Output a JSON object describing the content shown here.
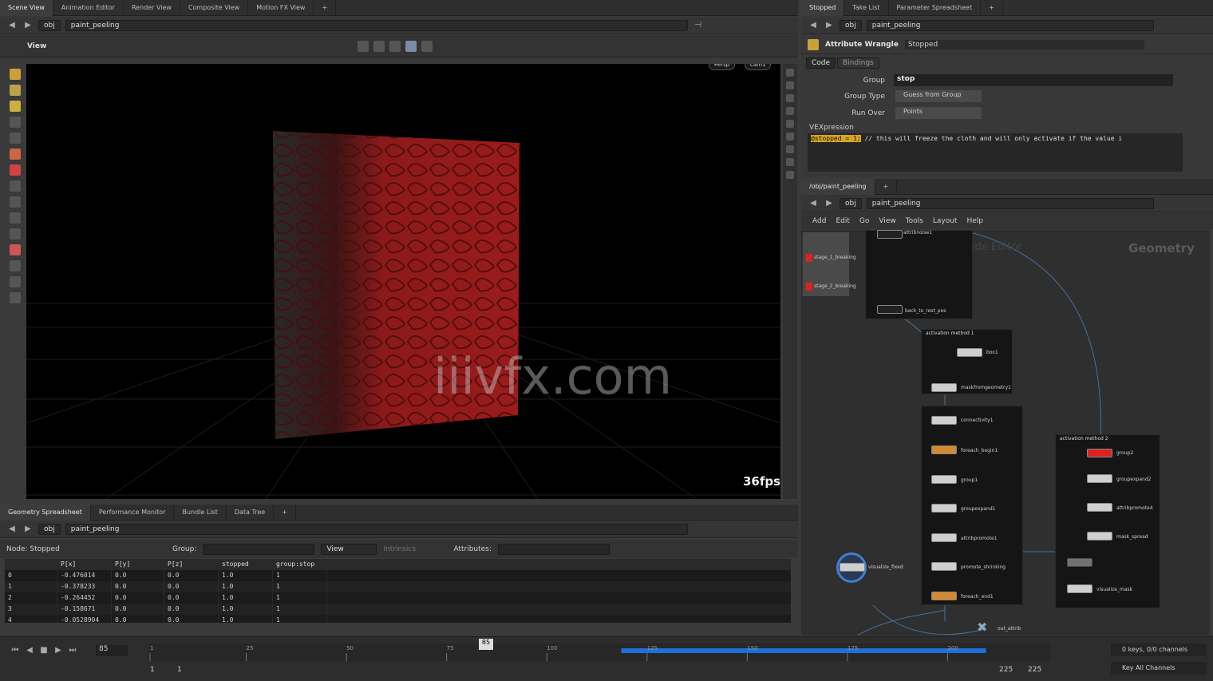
{
  "left_tabs": [
    "Scene View",
    "Animation Editor",
    "Render View",
    "Composite View",
    "Motion FX View"
  ],
  "right_tabs": [
    "Stopped",
    "Take List",
    "Parameter Spreadsheet"
  ],
  "path": {
    "obj": "obj",
    "node": "paint_peeling"
  },
  "viewer": {
    "title": "View",
    "persp": "Persp",
    "cam": "cam1",
    "fps": "36fps",
    "watermark": "iiivfx.com"
  },
  "wrangle": {
    "type": "Attribute Wrangle",
    "name": "Stopped",
    "tabs": [
      "Code",
      "Bindings"
    ],
    "group_label": "Group",
    "group_value": "stop",
    "group_type_label": "Group Type",
    "group_type_value": "Guess from Group",
    "run_over_label": "Run Over",
    "run_over_value": "Points",
    "vex_label": "VEXpression",
    "vex_highlight": "@stopped = 1;",
    "vex_comment": " // this will freeze the cloth and will only activate if the value i"
  },
  "network": {
    "path_tab": "/obj/paint_peeling",
    "menu": [
      "Add",
      "Edit",
      "Go",
      "View",
      "Tools",
      "Layout",
      "Help"
    ],
    "geo_label": "Geometry",
    "box1_title": "activation method 1",
    "box2_title": "activation method 2",
    "nodes": {
      "attribnoise1": "attribnoise1",
      "back": "back_to_rest_pos",
      "stage1": "stage_1_breaking",
      "stage2": "stage_2_breaking",
      "box1": "box1",
      "maskfrom": "maskfromgeometry1",
      "connectivity": "connectivity1",
      "foreach_begin": "foreach_begin1",
      "group1": "group1",
      "groupexpand": "groupexpand1",
      "attribpromote1": "attribpromote1",
      "promote_shrinking": "promote_shrinking",
      "foreach_end": "foreach_end1",
      "visualize_fixed": "visualize_fixed",
      "out_attrib": "out_attrib",
      "group2": "group2",
      "groupexpand2": "groupexpand2",
      "attribpromote4": "attribpromote4",
      "mask_spread": "mask_spread",
      "visualize_mask": "visualize_mask"
    }
  },
  "spreadsheet": {
    "tabs": [
      "Geometry Spreadsheet",
      "Performance Monitor",
      "Bundle List",
      "Data Tree"
    ],
    "node_label": "Node: Stopped",
    "group_label": "Group:",
    "view_label": "View",
    "intrinsics_label": "Intrinsics",
    "attributes_label": "Attributes:",
    "columns": [
      "",
      "P[x]",
      "P[y]",
      "P[z]",
      "stopped",
      "group:stop"
    ],
    "rows": [
      [
        "0",
        "-0.476014",
        "0.0",
        "0.0",
        "1.0",
        "1"
      ],
      [
        "1",
        "-0.378233",
        "0.0",
        "0.0",
        "1.0",
        "1"
      ],
      [
        "2",
        "-0.264452",
        "0.0",
        "0.0",
        "1.0",
        "1"
      ],
      [
        "3",
        "-0.158671",
        "0.0",
        "0.0",
        "1.0",
        "1"
      ],
      [
        "4",
        "-0.0528904",
        "0.0",
        "0.0",
        "1.0",
        "1"
      ]
    ]
  },
  "timeline": {
    "frame": "85",
    "marker": "85",
    "ticks": [
      "1",
      "25",
      "50",
      "75",
      "100",
      "125",
      "150",
      "175",
      "200"
    ],
    "start": "1",
    "start2": "1",
    "end": "225",
    "end2": "225",
    "keys": "0 keys, 0/0 channels",
    "keyall": "Key All Channels"
  },
  "colors": {
    "accent": "#1f6fd6",
    "nodeorange": "#d08a32",
    "nodered": "#d22"
  }
}
